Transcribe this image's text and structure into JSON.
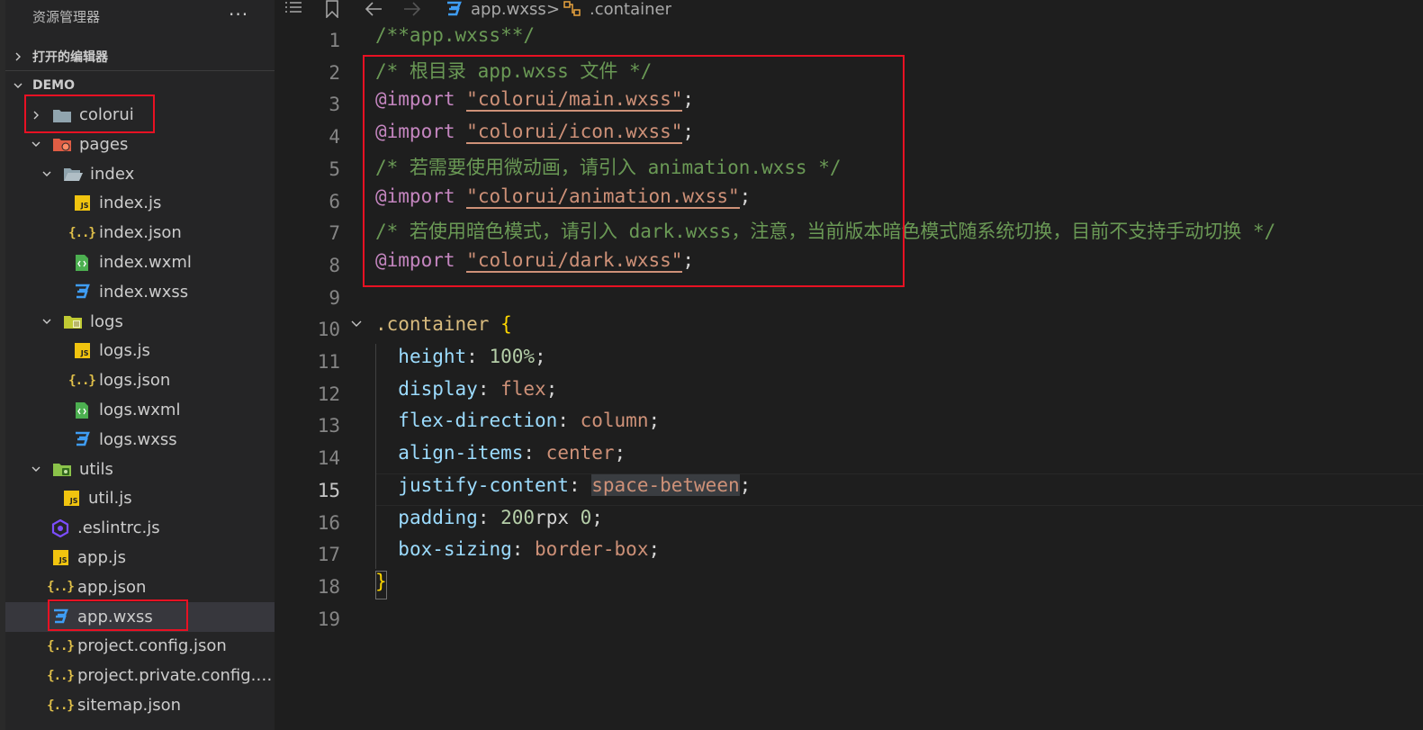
{
  "sidebar": {
    "title": "资源管理器",
    "more": "···",
    "sections": {
      "open_editors": "打开的编辑器",
      "project": "DEMO"
    },
    "tree": [
      {
        "label": "colorui",
        "icon": "folder-icon",
        "expandable": true,
        "expanded": false
      },
      {
        "label": "pages",
        "icon": "folder-pages-icon",
        "expandable": true,
        "expanded": true
      },
      {
        "label": "index",
        "icon": "folder-open-icon",
        "expandable": true,
        "expanded": true
      },
      {
        "label": "index.js",
        "icon": "js-file-icon"
      },
      {
        "label": "index.json",
        "icon": "json-file-icon"
      },
      {
        "label": "index.wxml",
        "icon": "wxml-file-icon"
      },
      {
        "label": "index.wxss",
        "icon": "wxss-file-icon"
      },
      {
        "label": "logs",
        "icon": "folder-logs-icon",
        "expandable": true,
        "expanded": true
      },
      {
        "label": "logs.js",
        "icon": "js-file-icon"
      },
      {
        "label": "logs.json",
        "icon": "json-file-icon"
      },
      {
        "label": "logs.wxml",
        "icon": "wxml-file-icon"
      },
      {
        "label": "logs.wxss",
        "icon": "wxss-file-icon"
      },
      {
        "label": "utils",
        "icon": "folder-utils-icon",
        "expandable": true,
        "expanded": true
      },
      {
        "label": "util.js",
        "icon": "js-file-icon"
      },
      {
        "label": ".eslintrc.js",
        "icon": "eslint-file-icon"
      },
      {
        "label": "app.js",
        "icon": "js-file-icon"
      },
      {
        "label": "app.json",
        "icon": "json-file-icon"
      },
      {
        "label": "app.wxss",
        "icon": "wxss-file-icon",
        "selected": true
      },
      {
        "label": "project.config.json",
        "icon": "json-file-icon"
      },
      {
        "label": "project.private.config.js...",
        "icon": "json-file-icon"
      },
      {
        "label": "sitemap.json",
        "icon": "json-file-icon"
      }
    ]
  },
  "editor": {
    "breadcrumb": {
      "file": "app.wxss",
      "separator": ">",
      "symbol": ".container"
    },
    "active_line": 15,
    "lines": [
      [
        {
          "t": "/**app.wxss**/",
          "c": "com"
        }
      ],
      [
        {
          "t": "/* 根目录 app.wxss 文件 */",
          "c": "com"
        }
      ],
      [
        {
          "t": "@import",
          "c": "kw"
        },
        {
          "t": " ",
          "c": "punc"
        },
        {
          "t": "\"colorui/main.wxss\"",
          "c": "str"
        },
        {
          "t": ";",
          "c": "punc"
        }
      ],
      [
        {
          "t": "@import",
          "c": "kw"
        },
        {
          "t": " ",
          "c": "punc"
        },
        {
          "t": "\"colorui/icon.wxss\"",
          "c": "str"
        },
        {
          "t": ";",
          "c": "punc"
        }
      ],
      [
        {
          "t": "/* 若需要使用微动画，请引入 animation.wxss */",
          "c": "com"
        }
      ],
      [
        {
          "t": "@import",
          "c": "kw"
        },
        {
          "t": " ",
          "c": "punc"
        },
        {
          "t": "\"colorui/animation.wxss\"",
          "c": "str"
        },
        {
          "t": ";",
          "c": "punc"
        }
      ],
      [
        {
          "t": "/* 若使用暗色模式，请引入 dark.wxss，注意，当前版本暗色模式随系统切换，目前不支持手动切换 */",
          "c": "com"
        }
      ],
      [
        {
          "t": "@import",
          "c": "kw"
        },
        {
          "t": " ",
          "c": "punc"
        },
        {
          "t": "\"colorui/dark.wxss\"",
          "c": "str"
        },
        {
          "t": ";",
          "c": "punc"
        }
      ],
      [],
      [
        {
          "t": ".container",
          "c": "sel"
        },
        {
          "t": " ",
          "c": "punc"
        },
        {
          "t": "{",
          "c": "brace"
        }
      ],
      [
        {
          "t": "  ",
          "c": "punc"
        },
        {
          "t": "height",
          "c": "prop"
        },
        {
          "t": ": ",
          "c": "punc"
        },
        {
          "t": "100%",
          "c": "num"
        },
        {
          "t": ";",
          "c": "punc"
        }
      ],
      [
        {
          "t": "  ",
          "c": "punc"
        },
        {
          "t": "display",
          "c": "prop"
        },
        {
          "t": ": ",
          "c": "punc"
        },
        {
          "t": "flex",
          "c": "val"
        },
        {
          "t": ";",
          "c": "punc"
        }
      ],
      [
        {
          "t": "  ",
          "c": "punc"
        },
        {
          "t": "flex-direction",
          "c": "prop"
        },
        {
          "t": ": ",
          "c": "punc"
        },
        {
          "t": "column",
          "c": "val"
        },
        {
          "t": ";",
          "c": "punc"
        }
      ],
      [
        {
          "t": "  ",
          "c": "punc"
        },
        {
          "t": "align-items",
          "c": "prop"
        },
        {
          "t": ": ",
          "c": "punc"
        },
        {
          "t": "center",
          "c": "val"
        },
        {
          "t": ";",
          "c": "punc"
        }
      ],
      [
        {
          "t": "  ",
          "c": "punc"
        },
        {
          "t": "justify-content",
          "c": "prop"
        },
        {
          "t": ": ",
          "c": "punc"
        },
        {
          "t": "space-between",
          "c": "val",
          "hl": true
        },
        {
          "t": ";",
          "c": "punc"
        }
      ],
      [
        {
          "t": "  ",
          "c": "punc"
        },
        {
          "t": "padding",
          "c": "prop"
        },
        {
          "t": ": ",
          "c": "punc"
        },
        {
          "t": "200",
          "c": "num"
        },
        {
          "t": "rpx ",
          "c": "punc"
        },
        {
          "t": "0",
          "c": "num"
        },
        {
          "t": ";",
          "c": "punc"
        }
      ],
      [
        {
          "t": "  ",
          "c": "punc"
        },
        {
          "t": "box-sizing",
          "c": "prop"
        },
        {
          "t": ": ",
          "c": "punc"
        },
        {
          "t": "border-box",
          "c": "val"
        },
        {
          "t": ";",
          "c": "punc"
        }
      ],
      [
        {
          "t": "}",
          "c": "brace"
        }
      ],
      []
    ]
  },
  "colors": {
    "annotation_box": "#e81123",
    "comment": "#6a9955",
    "keyword": "#c586c0",
    "string": "#ce9178",
    "property": "#9cdcfe",
    "selector": "#d7ba7d"
  }
}
